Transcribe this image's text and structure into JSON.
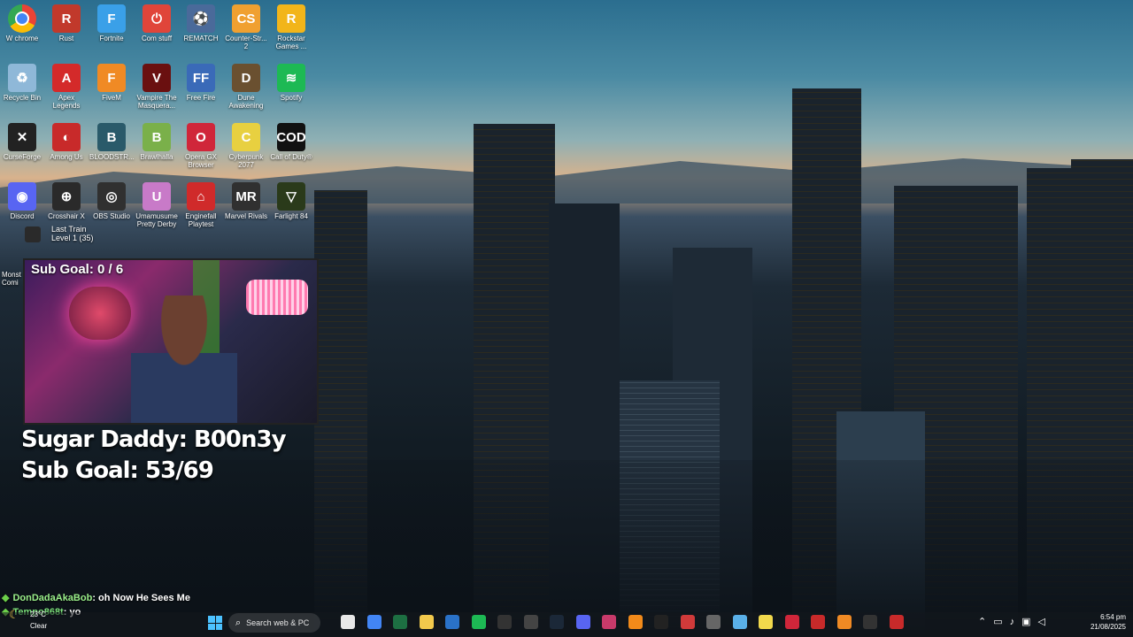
{
  "desktop_icons": [
    {
      "label": "W chrome",
      "glyph": "",
      "color": "#ffffff",
      "icon": "chrome-icon"
    },
    {
      "label": "Rust",
      "glyph": "R",
      "color": "#c1392b",
      "icon": "rust-icon"
    },
    {
      "label": "Fortnite",
      "glyph": "F",
      "color": "#3aa0e8",
      "icon": "fortnite-icon"
    },
    {
      "label": "Com stuff",
      "glyph": "⏻",
      "color": "#e0453a",
      "icon": "power-icon"
    },
    {
      "label": "REMATCH",
      "glyph": "⚽",
      "color": "#4a6a9a",
      "icon": "rematch-icon"
    },
    {
      "label": "Counter-Str... 2",
      "glyph": "CS",
      "color": "#f0a030",
      "icon": "counter-strike-icon"
    },
    {
      "label": "Rockstar Games ...",
      "glyph": "R",
      "color": "#f2b51a",
      "icon": "rockstar-icon"
    },
    {
      "label": "Recycle Bin",
      "glyph": "♻",
      "color": "#8fb8d8",
      "icon": "recycle-bin-icon"
    },
    {
      "label": "Apex Legends",
      "glyph": "A",
      "color": "#d42a2a",
      "icon": "apex-icon"
    },
    {
      "label": "FiveM",
      "glyph": "F",
      "color": "#f08a24",
      "icon": "fivem-icon"
    },
    {
      "label": "Vampire The Masquera...",
      "glyph": "V",
      "color": "#6a1010",
      "icon": "vampire-icon"
    },
    {
      "label": "Free Fire",
      "glyph": "FF",
      "color": "#3a6ab8",
      "icon": "free-fire-icon"
    },
    {
      "label": "Dune Awakening",
      "glyph": "D",
      "color": "#6a5030",
      "icon": "dune-icon"
    },
    {
      "label": "Spotify",
      "glyph": "≋",
      "color": "#1db954",
      "icon": "spotify-icon"
    },
    {
      "label": "CurseForge",
      "glyph": "✕",
      "color": "#222222",
      "icon": "curseforge-icon"
    },
    {
      "label": "Among Us",
      "glyph": "◐",
      "color": "#c82a2a",
      "icon": "among-us-icon"
    },
    {
      "label": "BLOODSTR...",
      "glyph": "B",
      "color": "#2a5a6a",
      "icon": "bloodstrike-icon"
    },
    {
      "label": "Brawlhalla",
      "glyph": "B",
      "color": "#7ab04a",
      "icon": "brawlhalla-icon"
    },
    {
      "label": "Opera GX Browser",
      "glyph": "O",
      "color": "#d0263a",
      "icon": "opera-gx-icon"
    },
    {
      "label": "Cyberpunk 2077",
      "glyph": "C",
      "color": "#e8d040",
      "icon": "cyberpunk-icon"
    },
    {
      "label": "Call of Duty®",
      "glyph": "COD",
      "color": "#111111",
      "icon": "call-of-duty-icon"
    },
    {
      "label": "Discord",
      "glyph": "◉",
      "color": "#5865f2",
      "icon": "discord-icon"
    },
    {
      "label": "Crosshair X",
      "glyph": "⊕",
      "color": "#2a2a2a",
      "icon": "crosshair-icon"
    },
    {
      "label": "OBS Studio",
      "glyph": "◎",
      "color": "#303030",
      "icon": "obs-icon"
    },
    {
      "label": "Umamusume Pretty Derby",
      "glyph": "U",
      "color": "#c87ac8",
      "icon": "umamusume-icon"
    },
    {
      "label": "Enginefall Playtest",
      "glyph": "⌂",
      "color": "#d02a2a",
      "icon": "enginefall-icon"
    },
    {
      "label": "Marvel Rivals",
      "glyph": "MR",
      "color": "#303030",
      "icon": "marvel-rivals-icon"
    },
    {
      "label": "Farlight 84",
      "glyph": "▽",
      "color": "#2a3a1a",
      "icon": "farlight-icon"
    }
  ],
  "last_train": {
    "line1": "Last Train",
    "line2": "Level 1 (35)"
  },
  "partial_icon": {
    "line1": "Monst",
    "line2": "Comi"
  },
  "cam": {
    "goal": "Sub Goal:  0 / 6"
  },
  "overlay": {
    "line1": "Sugar Daddy: B00n3y",
    "line2": "Sub Goal: 53/69"
  },
  "chat": [
    {
      "user": "DonDadaAkaBob",
      "message": "oh Now He Sees Me"
    },
    {
      "user": "Tempo868t",
      "message": "yo"
    }
  ],
  "weather": {
    "temp": "23°C",
    "condition": "Clear"
  },
  "search": {
    "placeholder": "Search web & PC"
  },
  "clock": {
    "time": "6:54 pm",
    "date": "21/08/2025"
  },
  "taskbar_apps": [
    "explorer-icon",
    "chrome-icon",
    "excel-icon",
    "folder-icon",
    "visio-icon",
    "spotify-icon",
    "app-icon",
    "obs-icon",
    "steam-icon",
    "discord-icon",
    "store-icon",
    "vlc-icon",
    "capcut-icon",
    "riot-icon",
    "app-icon",
    "photos-icon",
    "notes-icon",
    "opera-icon",
    "epic-icon",
    "fivem-icon",
    "terminal-icon",
    "app-icon"
  ]
}
